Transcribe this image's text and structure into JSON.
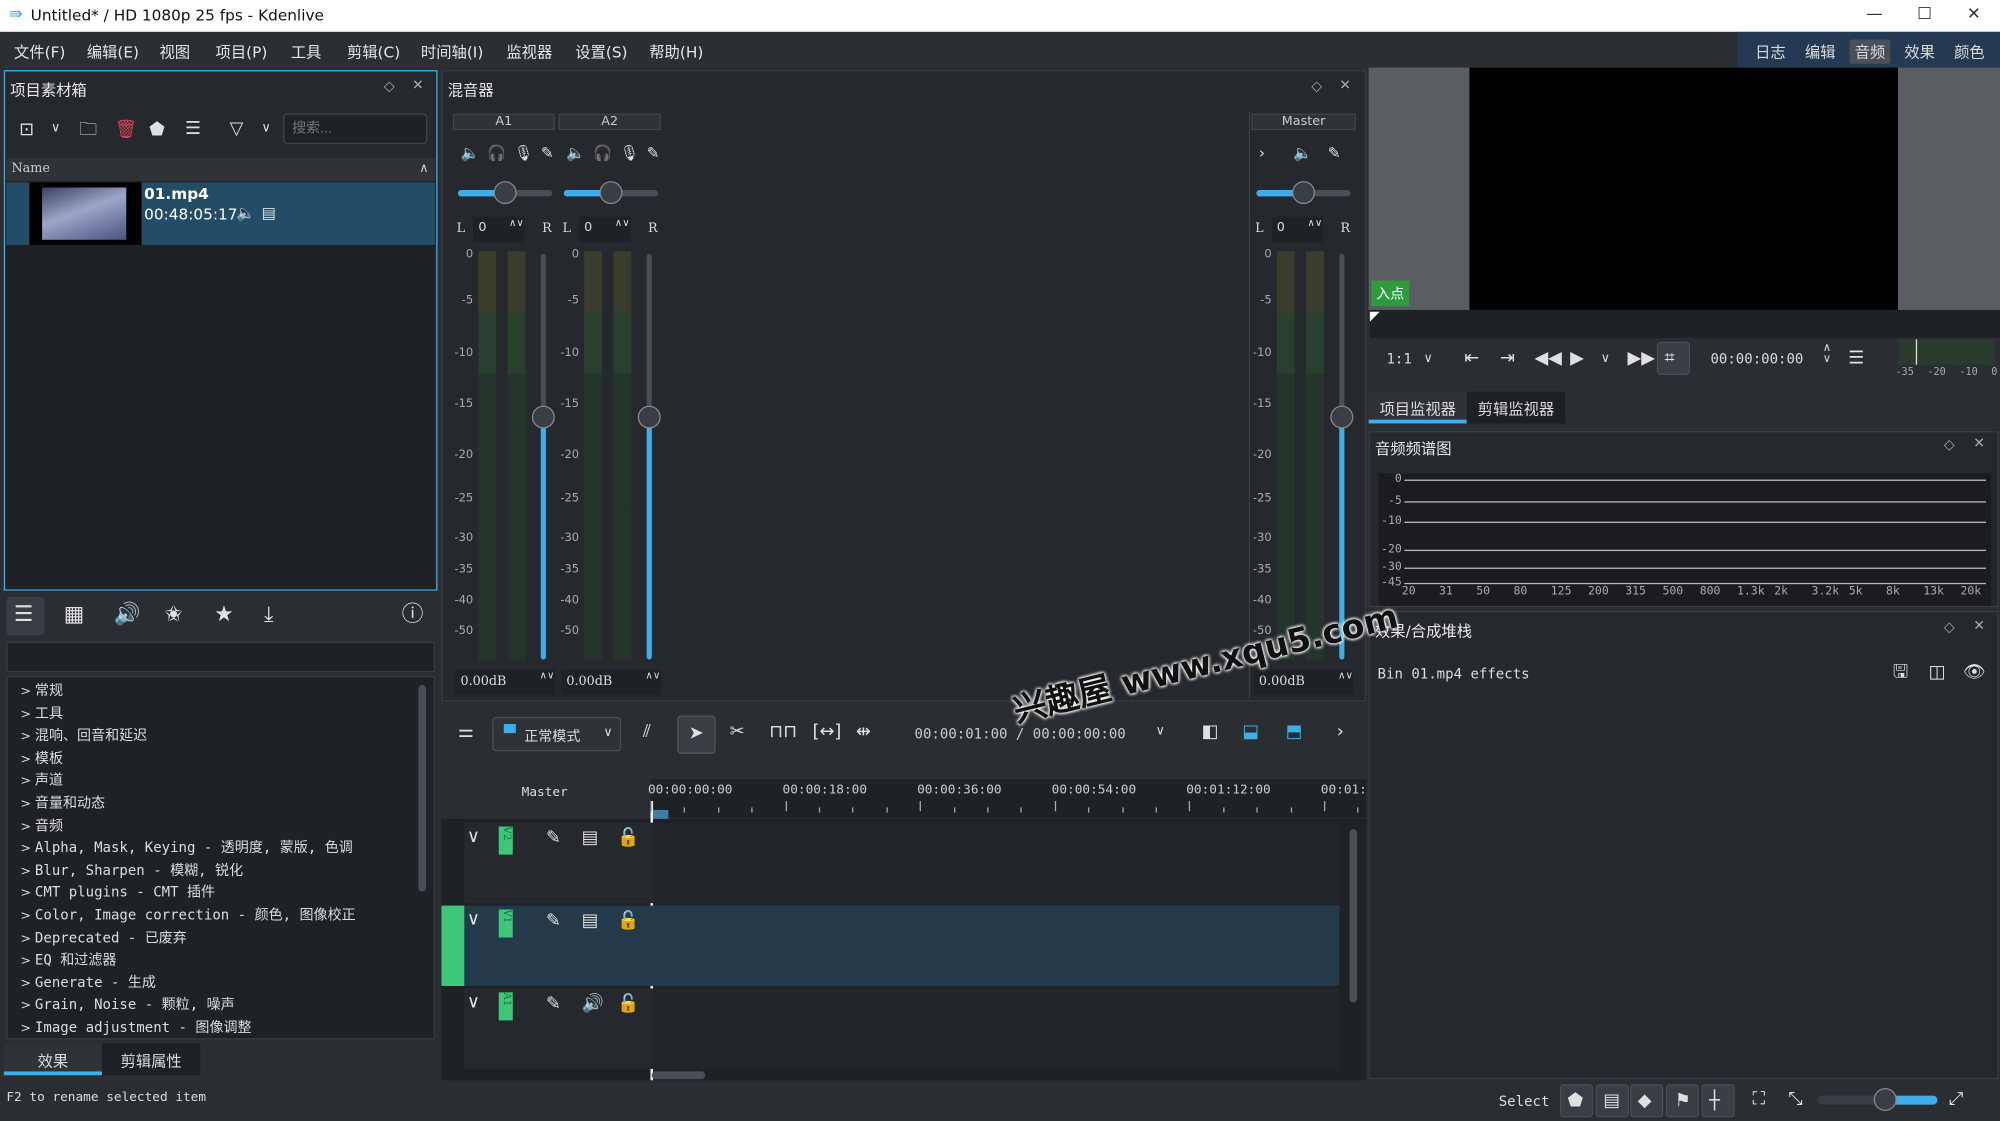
{
  "window": {
    "title": "Untitled* / HD 1080p 25 fps - Kdenlive"
  },
  "menu": [
    "文件(F)",
    "编辑(E)",
    "视图",
    "项目(P)",
    "工具",
    "剪辑(C)",
    "时间轴(I)",
    "监视器",
    "设置(S)",
    "帮助(H)"
  ],
  "workspaces": [
    {
      "label": "日志",
      "active": false
    },
    {
      "label": "编辑",
      "active": false
    },
    {
      "label": "音频",
      "active": true
    },
    {
      "label": "效果",
      "active": false
    },
    {
      "label": "颜色",
      "active": false
    }
  ],
  "bin": {
    "title": "项目素材箱",
    "search_placeholder": "搜索...",
    "column": "Name",
    "clip": {
      "name": "01.mp4",
      "duration": "00:48:05:17"
    }
  },
  "effects": {
    "categories": [
      "常规",
      "工具",
      "混响、回音和延迟",
      "模板",
      "声道",
      "音量和动态",
      "音频",
      "Alpha, Mask, Keying - 透明度, 蒙版, 色调",
      "Blur, Sharpen - 模糊, 锐化",
      "CMT plugins - CMT 插件",
      "Color, Image correction - 颜色, 图像校正",
      "Deprecated - 已废弃",
      "EQ 和过滤器",
      "Generate - 生成",
      "Grain, Noise - 颗粒, 噪声",
      "Image adjustment - 图像调整"
    ],
    "tabs": [
      {
        "label": "效果",
        "active": true
      },
      {
        "label": "剪辑属性",
        "active": false
      }
    ]
  },
  "status": {
    "message": "F2 to rename selected item",
    "tool": "Select"
  },
  "mixer": {
    "title": "混音器",
    "channels": [
      {
        "name": "A1",
        "pan": "0",
        "gain": "0.00dB"
      },
      {
        "name": "A2",
        "pan": "0",
        "gain": "0.00dB"
      }
    ],
    "master": {
      "name": "Master",
      "pan": "0",
      "gain": "0.00dB"
    },
    "left": "L",
    "right": "R",
    "scale": [
      "0",
      "-5",
      "-10",
      "-15",
      "-20",
      "-25",
      "-30",
      "-35",
      "-40",
      "-50"
    ]
  },
  "timeline": {
    "mode": "正常模式",
    "timecode": "00:00:01:00 / 00:00:00:00",
    "master": "Master",
    "ruler": [
      "00:00:00:00",
      "00:00:18:00",
      "00:00:36:00",
      "00:00:54:00",
      "00:01:12:00",
      "00:01:"
    ],
    "tracks": [
      {
        "name": "V2",
        "type": "video",
        "selected": false
      },
      {
        "name": "V1",
        "type": "video",
        "selected": true
      },
      {
        "name": "A1",
        "type": "audio",
        "selected": false
      }
    ]
  },
  "monitor": {
    "in_point": "入点",
    "zoom": "1:1",
    "timecode": "00:00:00:00",
    "meter_scale": [
      "-35",
      "-20",
      "-10",
      "0"
    ],
    "tabs": [
      {
        "label": "项目监视器",
        "active": true
      },
      {
        "label": "剪辑监视器",
        "active": false
      }
    ]
  },
  "spectrum": {
    "title": "音频频谱图",
    "y_ticks": [
      "0",
      "-5",
      "-10",
      "-20",
      "-30",
      "-45"
    ],
    "x_ticks": [
      "20",
      "31",
      "50",
      "80",
      "125",
      "200",
      "315",
      "500",
      "800",
      "1.3k",
      "2k",
      "3.2k",
      "5k",
      "8k",
      "13k",
      "20k"
    ]
  },
  "effect_stack": {
    "title": "效果/合成堆栈",
    "label": "Bin 01.mp4 effects"
  },
  "watermark": "兴趣屋 www.xqu5.com",
  "colors": {
    "accent": "#3daee9",
    "track_green": "#3ec778",
    "selection": "#234d66"
  }
}
